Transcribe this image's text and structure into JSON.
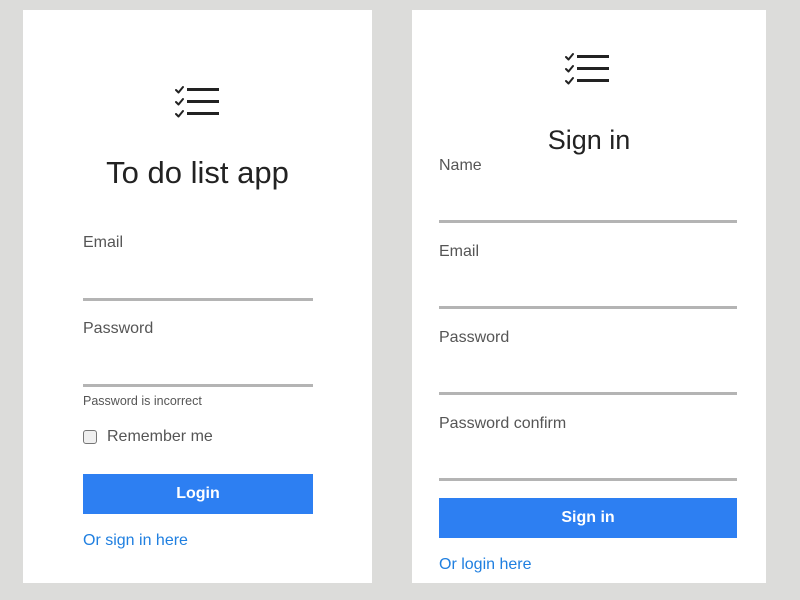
{
  "login": {
    "logo_icon": "checklist-icon",
    "title": "To do list app",
    "email_label": "Email",
    "email_value": "",
    "password_label": "Password",
    "password_value": "",
    "password_error": "Password is incorrect",
    "remember_label": "Remember me",
    "remember_checked": false,
    "submit_label": "Login",
    "switch_link": "Or sign in here"
  },
  "signup": {
    "logo_icon": "checklist-icon",
    "title": "Sign in",
    "name_label": "Name",
    "name_value": "",
    "email_label": "Email",
    "email_value": "",
    "password_label": "Password",
    "password_value": "",
    "password_confirm_label": "Password confirm",
    "password_confirm_value": "",
    "submit_label": "Sign in",
    "switch_link": "Or login here"
  },
  "colors": {
    "background": "#dcdcda",
    "card": "#ffffff",
    "primary_button": "#2d7ff2",
    "link": "#1f7fe0",
    "input_underline": "#b4b4b4",
    "label": "#555555"
  }
}
